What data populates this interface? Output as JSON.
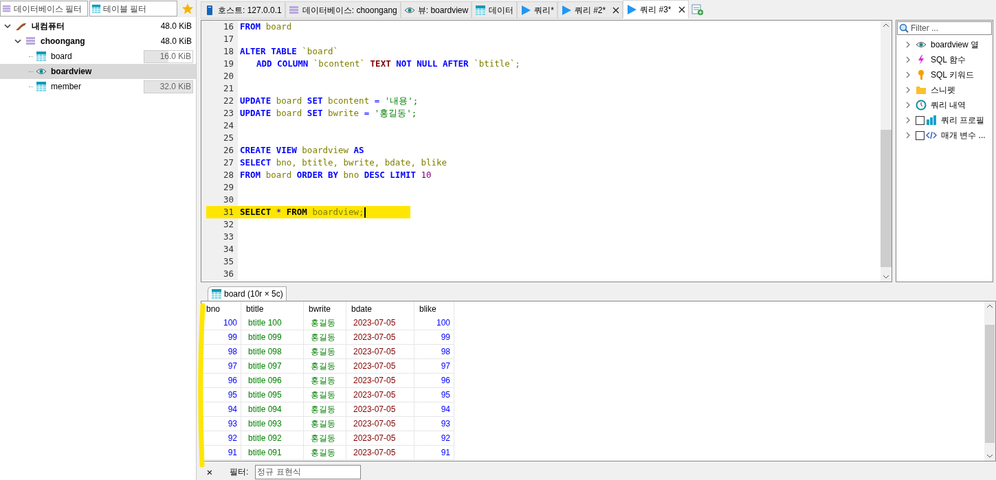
{
  "sidebar": {
    "filters": [
      {
        "kind": "database",
        "placeholder": "데이터베이스 필터"
      },
      {
        "kind": "table",
        "placeholder": "테이블 필터"
      }
    ],
    "tree": [
      {
        "kind": "server",
        "label": "내컴퓨터",
        "size": "48.0 KiB",
        "expanded": true,
        "selected": false,
        "children": [
          {
            "kind": "database",
            "label": "choongang",
            "size": "48.0 KiB",
            "expanded": true,
            "selected": false,
            "children": [
              {
                "kind": "table",
                "label": "board",
                "size": "16.0 KiB",
                "level": 0.5,
                "selected": false
              },
              {
                "kind": "view",
                "label": "boardview",
                "selected": true
              },
              {
                "kind": "table",
                "label": "member",
                "size": "32.0 KiB",
                "level": 1,
                "selected": false
              }
            ]
          }
        ]
      }
    ]
  },
  "tabs": [
    {
      "kind": "host",
      "label": "호스트: 127.0.0.1",
      "selected": false,
      "closable": false
    },
    {
      "kind": "database",
      "label": "데이터베이스: choongang",
      "selected": false,
      "closable": false
    },
    {
      "kind": "view",
      "label": "뷰: boardview",
      "selected": false,
      "closable": false
    },
    {
      "kind": "data",
      "label": "데이터",
      "selected": false,
      "closable": false
    },
    {
      "kind": "query",
      "label": "쿼리*",
      "selected": false,
      "closable": false
    },
    {
      "kind": "query",
      "label": "쿼리 #2*",
      "selected": false,
      "closable": true
    },
    {
      "kind": "query",
      "label": "쿼리 #3*",
      "selected": true,
      "closable": true
    }
  ],
  "editor": {
    "lines": [
      {
        "number": "16",
        "highlighted": false,
        "indented": false,
        "tokens": [
          {
            "kind": "keyword",
            "text": "FROM"
          },
          {
            "kind": "ident",
            "text": "board"
          }
        ]
      },
      {
        "number": "17",
        "highlighted": false,
        "indented": false
      },
      {
        "number": "18",
        "highlighted": false,
        "indented": false,
        "tokens": [
          {
            "kind": "keyword",
            "text": "ALTER"
          },
          {
            "kind": "keyword",
            "text": "TABLE"
          },
          {
            "kind": "ident",
            "text": "`board`"
          }
        ]
      },
      {
        "number": "19",
        "highlighted": false,
        "indented": true,
        "tokens": [
          {
            "kind": "keyword",
            "text": "ADD"
          },
          {
            "kind": "keyword",
            "text": "COLUMN"
          },
          {
            "kind": "ident",
            "text": "`bcontent`"
          },
          {
            "kind": "type",
            "text": "TEXT"
          },
          {
            "kind": "keyword",
            "text": "NOT"
          },
          {
            "kind": "keyword",
            "text": "NULL"
          },
          {
            "kind": "keyword",
            "text": "AFTER"
          },
          {
            "kind": "ident",
            "text": "`btitle`;"
          }
        ]
      },
      {
        "number": "20",
        "highlighted": false,
        "indented": false
      },
      {
        "number": "21",
        "highlighted": false,
        "indented": false
      },
      {
        "number": "22",
        "highlighted": false,
        "indented": false,
        "tokens": [
          {
            "kind": "keyword",
            "text": "UPDATE"
          },
          {
            "kind": "ident",
            "text": "board"
          },
          {
            "kind": "keyword",
            "text": "SET"
          },
          {
            "kind": "ident",
            "text": "bcontent"
          },
          {
            "kind": "operator",
            "text": "="
          },
          {
            "kind": "string",
            "text": "'내용';"
          }
        ]
      },
      {
        "number": "23",
        "highlighted": false,
        "indented": false,
        "tokens": [
          {
            "kind": "keyword",
            "text": "UPDATE"
          },
          {
            "kind": "ident",
            "text": "board"
          },
          {
            "kind": "keyword",
            "text": "SET"
          },
          {
            "kind": "ident",
            "text": "bwrite"
          },
          {
            "kind": "operator",
            "text": "="
          },
          {
            "kind": "string",
            "text": "'홍길동';"
          }
        ]
      },
      {
        "number": "24",
        "highlighted": false,
        "indented": false
      },
      {
        "number": "25",
        "highlighted": false,
        "indented": false
      },
      {
        "number": "26",
        "highlighted": false,
        "indented": false,
        "tokens": [
          {
            "kind": "keyword",
            "text": "CREATE"
          },
          {
            "kind": "keyword",
            "text": "VIEW"
          },
          {
            "kind": "ident",
            "text": "boardview"
          },
          {
            "kind": "keyword",
            "text": "AS"
          }
        ]
      },
      {
        "number": "27",
        "highlighted": false,
        "indented": false,
        "tokens": [
          {
            "kind": "keyword",
            "text": "SELECT"
          },
          {
            "kind": "ident",
            "text": "bno,"
          },
          {
            "kind": "ident",
            "text": "btitle,"
          },
          {
            "kind": "ident",
            "text": "bwrite,"
          },
          {
            "kind": "ident",
            "text": "bdate,"
          },
          {
            "kind": "ident",
            "text": "blike"
          }
        ]
      },
      {
        "number": "28",
        "highlighted": false,
        "indented": false,
        "tokens": [
          {
            "kind": "keyword",
            "text": "FROM"
          },
          {
            "kind": "ident",
            "text": "board"
          },
          {
            "kind": "keyword",
            "text": "ORDER"
          },
          {
            "kind": "keyword",
            "text": "BY"
          },
          {
            "kind": "ident",
            "text": "bno"
          },
          {
            "kind": "keyword",
            "text": "DESC"
          },
          {
            "kind": "keyword",
            "text": "LIMIT"
          },
          {
            "kind": "number",
            "text": "10"
          }
        ]
      },
      {
        "number": "29",
        "highlighted": false,
        "indented": false
      },
      {
        "number": "30",
        "highlighted": false,
        "indented": false
      },
      {
        "number": "31",
        "highlighted": true,
        "indented": false,
        "tokens": [
          {
            "kind": "keyword",
            "text": "SELECT"
          },
          {
            "kind": "operator",
            "text": "*"
          },
          {
            "kind": "keyword",
            "text": "FROM"
          },
          {
            "kind": "ident",
            "text": "boardview;"
          }
        ]
      },
      {
        "number": "32",
        "highlighted": false,
        "indented": false
      },
      {
        "number": "33",
        "highlighted": false,
        "indented": false
      },
      {
        "number": "34",
        "highlighted": false,
        "indented": false
      },
      {
        "number": "35",
        "highlighted": false,
        "indented": false
      },
      {
        "number": "36",
        "highlighted": false,
        "indented": false
      }
    ]
  },
  "helper": {
    "placeholder": "Filter ...",
    "items": [
      {
        "kind": "columns",
        "label": "boardview 열"
      },
      {
        "kind": "functions",
        "label": "SQL 함수"
      },
      {
        "kind": "keywords",
        "label": "SQL 키워드"
      },
      {
        "kind": "snippets",
        "label": "스니펫"
      },
      {
        "kind": "history",
        "label": "쿼리 내역"
      },
      {
        "kind": "profile",
        "label": "쿼리 프로필",
        "checked": false
      },
      {
        "kind": "params",
        "label": "매개 변수 ...",
        "checked": false
      }
    ]
  },
  "result": {
    "tab": "board (10r × 5c)",
    "columns": [
      {
        "label": "bno",
        "kind": "number"
      },
      {
        "label": "btitle",
        "kind": "text"
      },
      {
        "label": "bwrite",
        "kind": "text"
      },
      {
        "label": "bdate",
        "kind": "date"
      },
      {
        "label": "blike",
        "kind": "number"
      }
    ],
    "rows": [
      [
        "100",
        "btitle 100",
        "홍길동",
        "2023-07-05",
        "100"
      ],
      [
        "99",
        "btitle 099",
        "홍길동",
        "2023-07-05",
        "99"
      ],
      [
        "98",
        "btitle 098",
        "홍길동",
        "2023-07-05",
        "98"
      ],
      [
        "97",
        "btitle 097",
        "홍길동",
        "2023-07-05",
        "97"
      ],
      [
        "96",
        "btitle 096",
        "홍길동",
        "2023-07-05",
        "96"
      ],
      [
        "95",
        "btitle 095",
        "홍길동",
        "2023-07-05",
        "95"
      ],
      [
        "94",
        "btitle 094",
        "홍길동",
        "2023-07-05",
        "94"
      ],
      [
        "93",
        "btitle 093",
        "홍길동",
        "2023-07-05",
        "93"
      ],
      [
        "92",
        "btitle 092",
        "홍길동",
        "2023-07-05",
        "92"
      ],
      [
        "91",
        "btitle 091",
        "홍길동",
        "2023-07-05",
        "91"
      ]
    ]
  },
  "filter_bar": {
    "close": "×",
    "label": "필터:",
    "placeholder": "정규 표현식"
  }
}
